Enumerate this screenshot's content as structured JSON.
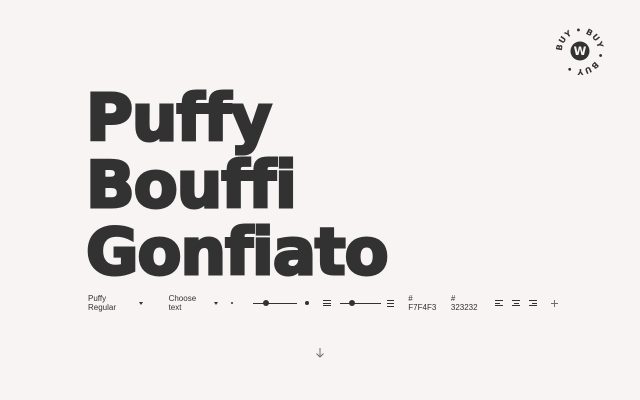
{
  "badge": {
    "ring_text": "BUY • BUY • BUY •",
    "center": "W"
  },
  "specimen": {
    "lines": [
      "Puffy",
      "Bouffi",
      "Gonfiato"
    ]
  },
  "toolbar": {
    "font_select": "Puffy Regular",
    "text_select": "Choose text",
    "size_slider_value": 0.3,
    "leading_slider_value": 0.3,
    "bg_color": "# F7F4F3",
    "fg_color": "# 323232",
    "icons": {
      "size_min": "dot-small-icon",
      "size_max": "dot-large-icon",
      "leading_min": "line-spacing-tight-icon",
      "leading_max": "line-spacing-loose-icon",
      "align_left": "align-left-icon",
      "align_center": "align-center-icon",
      "align_right": "align-right-icon",
      "add": "plus-icon"
    }
  },
  "scroll": {
    "icon": "arrow-down-icon"
  },
  "colors": {
    "background": "#F7F4F3",
    "foreground": "#323232"
  }
}
